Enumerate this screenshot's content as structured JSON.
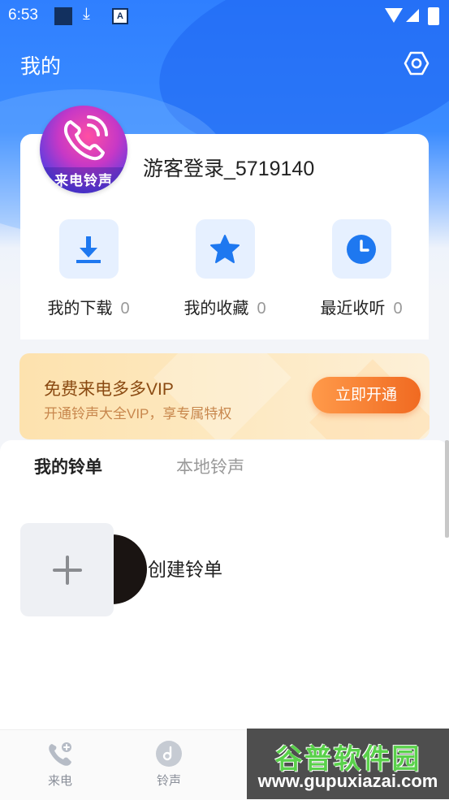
{
  "status_bar": {
    "time": "6:53",
    "download_icon": "⤓",
    "a_icon": "A"
  },
  "header": {
    "title": "我的"
  },
  "user": {
    "name": "游客登录_5719140",
    "avatar_text": "来电铃声"
  },
  "quick_actions": [
    {
      "label": "我的下载",
      "count": "0",
      "icon": "download-icon"
    },
    {
      "label": "我的收藏",
      "count": "0",
      "icon": "star-icon"
    },
    {
      "label": "最近收听",
      "count": "0",
      "icon": "clock-icon"
    }
  ],
  "vip": {
    "title": "免费来电多多VIP",
    "subtitle": "开通铃声大全VIP，享专属特权",
    "button": "立即开通"
  },
  "tabs": {
    "active": "我的铃单",
    "inactive": "本地铃声"
  },
  "playlist": {
    "create_label": "创建铃单"
  },
  "bottom_nav": [
    {
      "label": "来电",
      "icon": "phone-icon"
    },
    {
      "label": "铃声",
      "icon": "music-disc-icon"
    }
  ],
  "watermark": {
    "top": "谷普软件园",
    "bottom": "www.gupuxiazai.com"
  },
  "colors": {
    "primary": "#2f7fff",
    "icon_blue": "#1e78f0",
    "vip_button": "#f06a21"
  }
}
